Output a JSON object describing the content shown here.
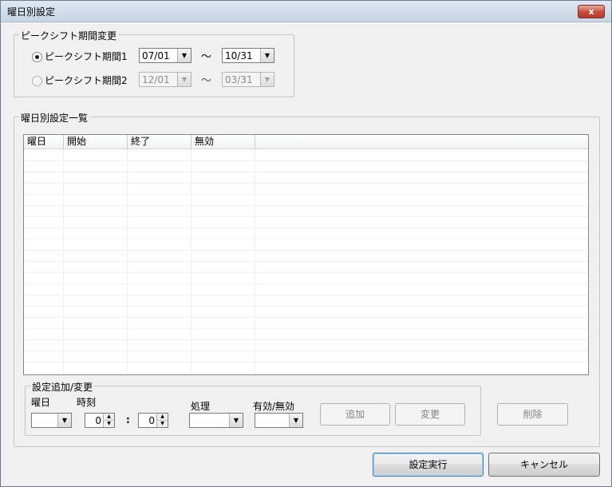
{
  "window": {
    "title": "曜日別設定",
    "close_label": "x"
  },
  "peak_shift": {
    "group_label": "ピークシフト期間変更",
    "period1": {
      "label": "ピークシフト期間1",
      "start": "07/01",
      "end": "10/31",
      "selected": true
    },
    "period2": {
      "label": "ピークシフト期間2",
      "start": "12/01",
      "end": "03/31",
      "selected": false
    },
    "separator": "～"
  },
  "list": {
    "group_label": "曜日別設定一覧",
    "columns": [
      "曜日",
      "開始",
      "終了",
      "無効",
      ""
    ],
    "rows": []
  },
  "edit": {
    "group_label": "設定追加/変更",
    "weekday_label": "曜日",
    "time_label": "時刻",
    "hour_value": "0",
    "colon": ":",
    "minute_value": "0",
    "action_label": "処理",
    "enabled_label": "有効/無効",
    "add_button": "追加",
    "change_button": "変更",
    "delete_button": "削除"
  },
  "footer": {
    "execute_button": "設定実行",
    "cancel_button": "キャンセル"
  },
  "icons": {
    "radio": "radio-icon",
    "dropdown": "chevron-down-icon",
    "spin": "spin-arrows-icon"
  }
}
